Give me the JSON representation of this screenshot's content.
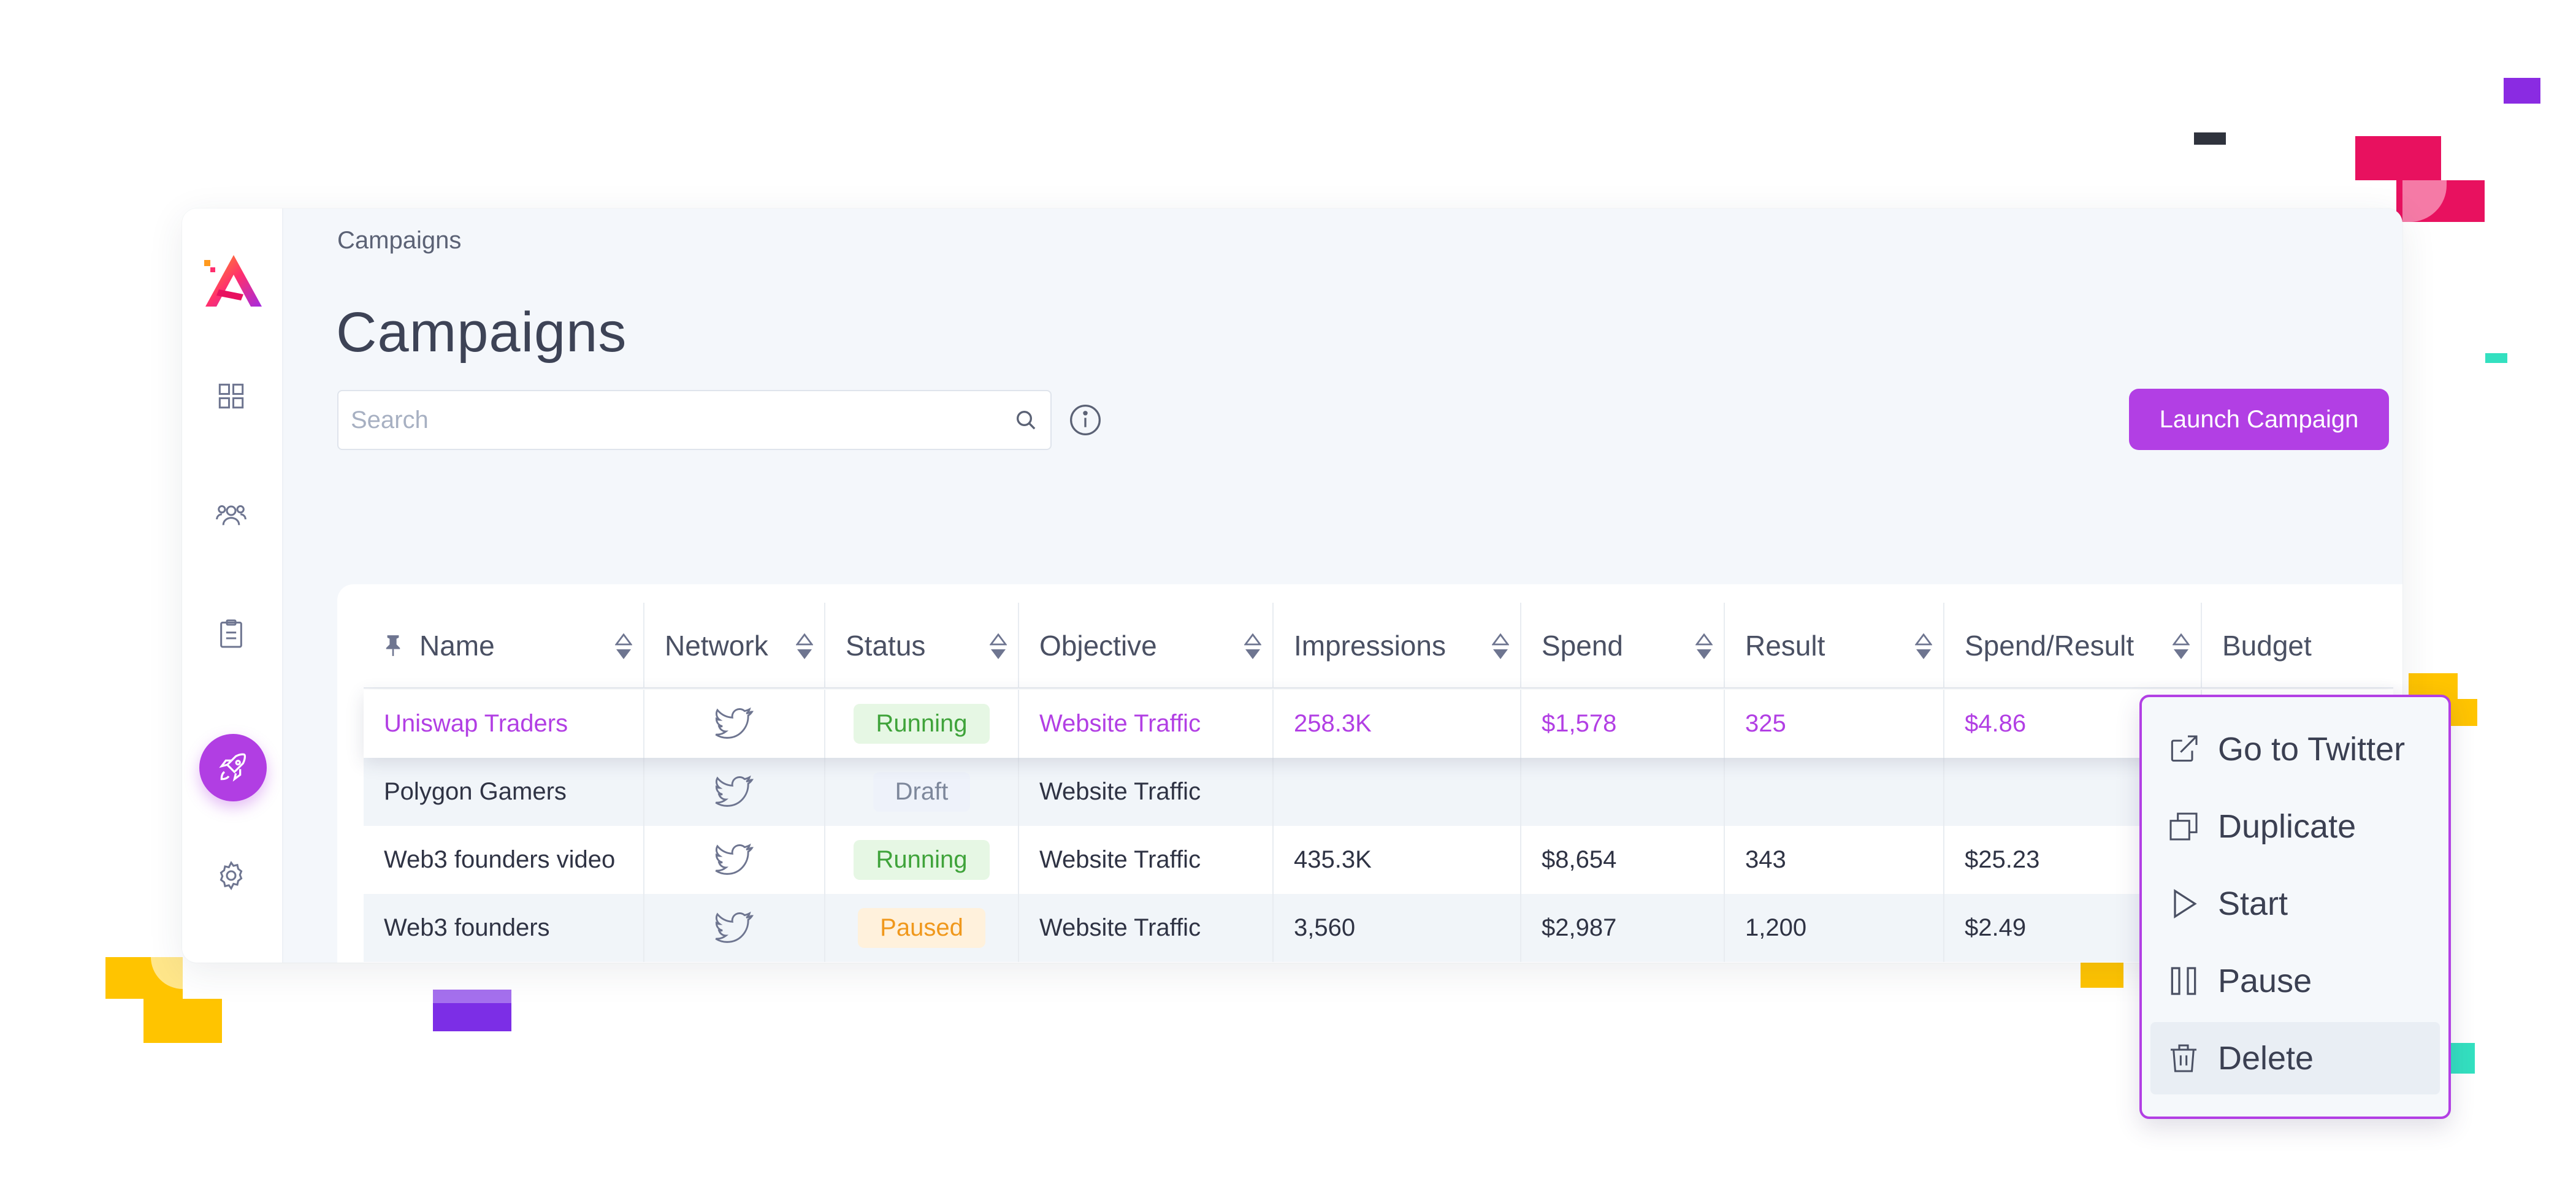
{
  "breadcrumb": "Campaigns",
  "page_title": "Campaigns",
  "search": {
    "placeholder": "Search"
  },
  "launch_button": "Launch Campaign",
  "sidebar": {
    "items": [
      {
        "name": "dashboard",
        "icon": "grid-icon"
      },
      {
        "name": "audiences",
        "icon": "users-icon"
      },
      {
        "name": "reports",
        "icon": "clipboard-icon"
      },
      {
        "name": "campaigns",
        "icon": "rocket-icon",
        "active": true
      },
      {
        "name": "settings",
        "icon": "gear-icon"
      }
    ]
  },
  "table": {
    "columns": [
      "Name",
      "Network",
      "Status",
      "Objective",
      "Impressions",
      "Spend",
      "Result",
      "Spend/Result",
      "Budget"
    ],
    "rows": [
      {
        "name": "Uniswap Traders",
        "network": "twitter-icon",
        "status": "Running",
        "objective": "Website Traffic",
        "impressions": "258.3K",
        "spend": "$1,578",
        "result": "325",
        "spend_result": "$4.86",
        "budget": ""
      },
      {
        "name": "Polygon Gamers",
        "network": "twitter-icon",
        "status": "Draft",
        "objective": "Website Traffic",
        "impressions": "",
        "spend": "",
        "result": "",
        "spend_result": "",
        "budget": ""
      },
      {
        "name": "Web3 founders video",
        "network": "twitter-icon",
        "status": "Running",
        "objective": "Website Traffic",
        "impressions": "435.3K",
        "spend": "$8,654",
        "result": "343",
        "spend_result": "$25.23",
        "budget": ""
      },
      {
        "name": "Web3 founders",
        "network": "twitter-icon",
        "status": "Paused",
        "objective": "Website Traffic",
        "impressions": "3,560",
        "spend": "$2,987",
        "result": "1,200",
        "spend_result": "$2.49",
        "budget": ""
      }
    ]
  },
  "context_menu": {
    "items": [
      {
        "label": "Go to Twitter",
        "icon": "external-link-icon"
      },
      {
        "label": "Duplicate",
        "icon": "copy-icon"
      },
      {
        "label": "Start",
        "icon": "play-icon"
      },
      {
        "label": "Pause",
        "icon": "pause-icon"
      },
      {
        "label": "Delete",
        "icon": "trash-icon",
        "active": true
      }
    ]
  },
  "colors": {
    "accent": "#b23fe4",
    "running_bg": "#e6f7e4",
    "running_text": "#3fa33a",
    "draft_bg": "#eef2fa",
    "draft_text": "#7d879b",
    "paused_bg": "#fff1dc",
    "paused_text": "#f0981c"
  }
}
